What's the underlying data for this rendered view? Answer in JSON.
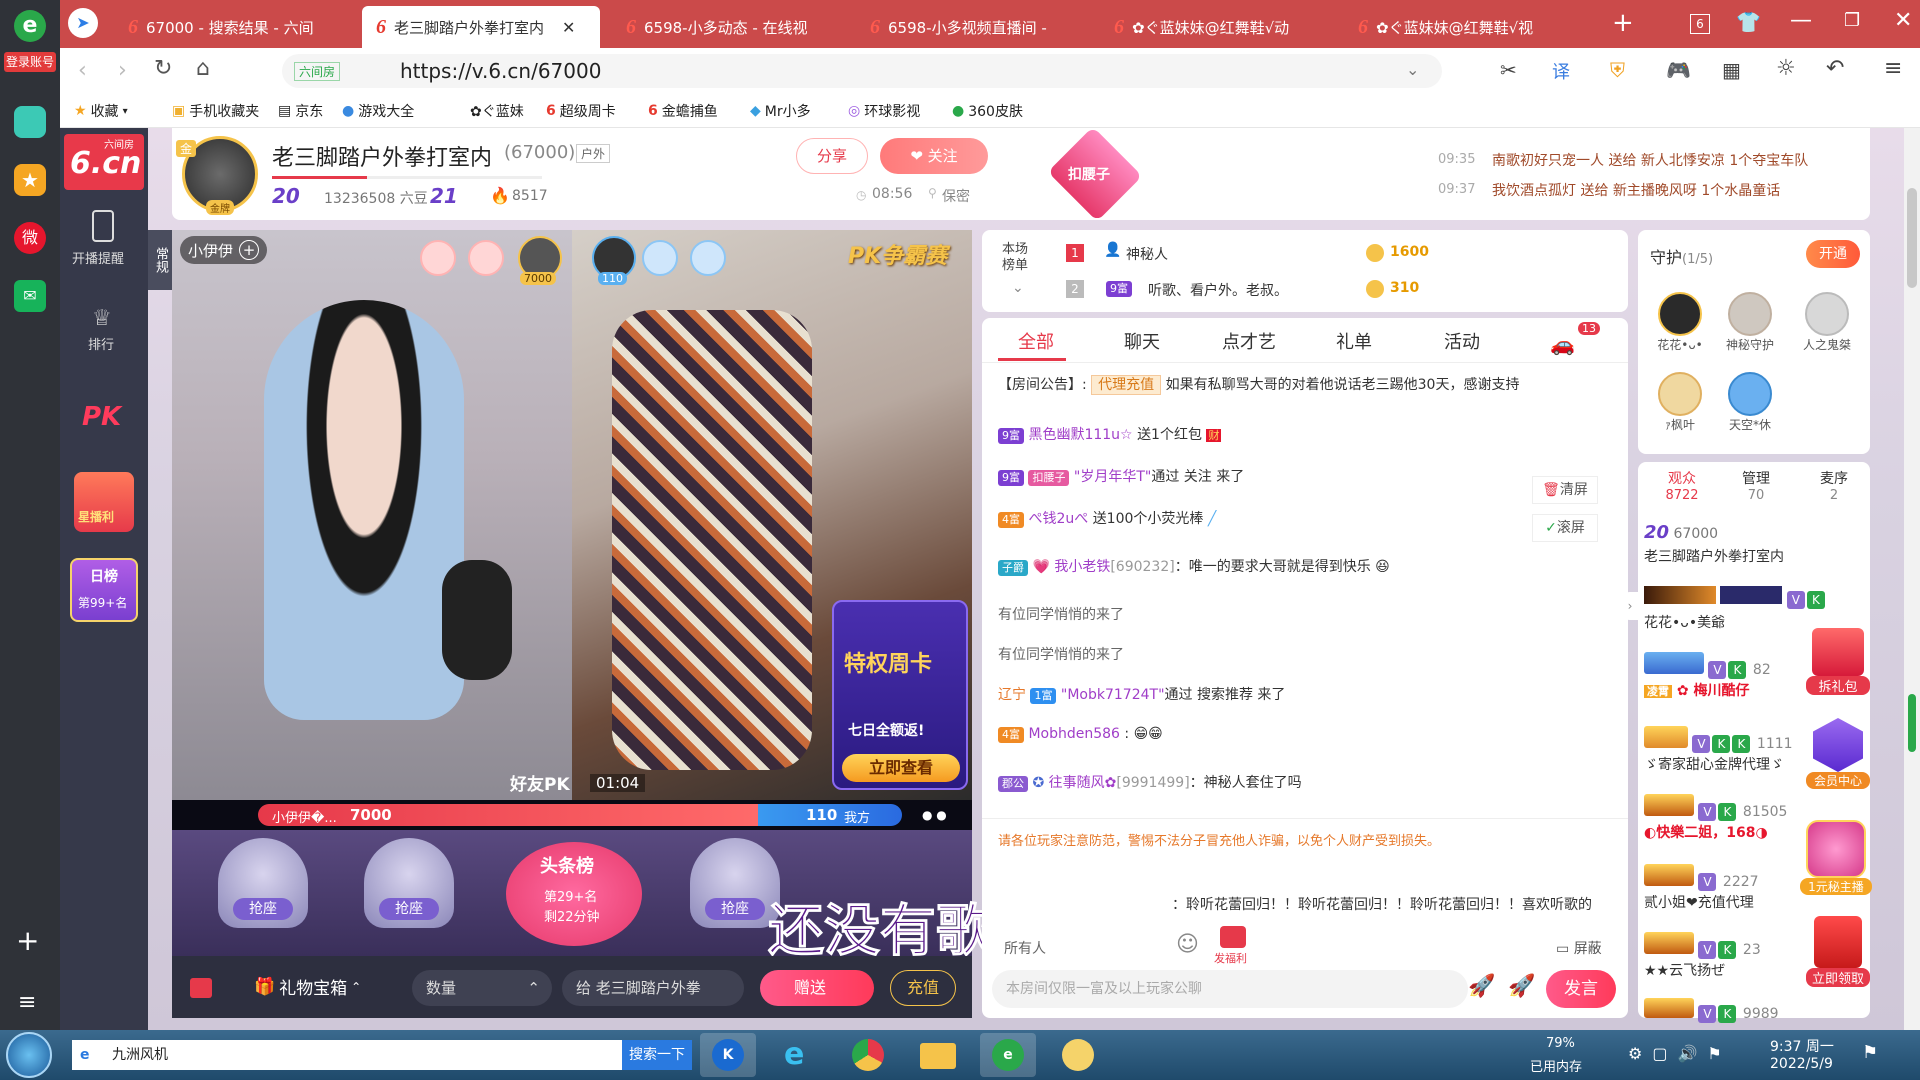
{
  "browser": {
    "login_label": "登录账号",
    "tabs": [
      {
        "title": "67000 - 搜索结果 - 六间"
      },
      {
        "title": "老三脚踏户外拳打室内"
      },
      {
        "title": "6598-小多动态 - 在线视"
      },
      {
        "title": "6598-小多视频直播间 - "
      },
      {
        "title": "✿ぐ蓝妹妹@红舞鞋√动"
      },
      {
        "title": "✿ぐ蓝妹妹@红舞鞋√视"
      }
    ],
    "tab_count": "6",
    "url": "https://v.6.cn/67000",
    "url_site_badge": "六间房",
    "bookmarks": [
      "收藏",
      "手机收藏夹",
      "京东",
      "游戏大全",
      "✿ぐ蓝妹",
      "超级周卡",
      "金蟾捕鱼",
      "Mr小多",
      "环球影视",
      "360皮肤"
    ],
    "translate_label": "译"
  },
  "site_nav": {
    "logo_top": "六间房",
    "logo_main": "6.cn",
    "items": [
      "开播提醒",
      "排行"
    ],
    "pk_label": "PK",
    "event_label": "星播利",
    "daily_rank_label": "日榜",
    "daily_rank_value": "第99+名"
  },
  "room": {
    "title": "老三脚踏户外拳打室内",
    "room_id": "(67000)",
    "category": "户外",
    "level_1": "20",
    "beans": "13236508 六豆",
    "level_2": "21",
    "fire": "8517",
    "time": "08:56",
    "location": "保密",
    "share_label": "分享",
    "follow_label": "关注",
    "waist_label": "扣腰子",
    "gold_label": "金",
    "avatar_badge": "金牌"
  },
  "notices": [
    {
      "time": "09:35",
      "text": "南歌初好只宠一人 送给 新人北悸安凉 1个夺宝车队"
    },
    {
      "time": "09:37",
      "text": "我饮酒点孤灯 送给 新主播晚风呀 1个水晶童话"
    }
  ],
  "video": {
    "side_tab": "常规",
    "anchor_name": "小伊伊",
    "left_score_badge": "7000",
    "right_score_badge": "110",
    "pk_logo": "PK争霸赛",
    "friend_pk": "好友PK",
    "timer": "01:04",
    "bar_left_name": "小伊伊�...",
    "bar_left_score": "7000",
    "bar_right_score": "110",
    "bar_right_label": "我方",
    "promo_title": "特权周卡",
    "promo_sub": "七日全额返!",
    "promo_btn": "立即查看",
    "seats": [
      "抢座",
      "抢座",
      "抢座"
    ],
    "headline_title": "头条榜",
    "headline_rank": "第29+名",
    "headline_time": "剩22分钟",
    "lyrics": "还没有歌词哦",
    "gift_box_label": "礼物宝箱",
    "qty_placeholder": "数量",
    "give_to": "给  老三脚踏户外拳",
    "give_btn": "赠送",
    "recharge_btn": "充值"
  },
  "ranking": {
    "label": "本场榜单",
    "rows": [
      {
        "rank": "1",
        "name": "神秘人",
        "value": "1600"
      },
      {
        "rank": "2",
        "badge": "9富",
        "name": "听歌、看户外。老叔。",
        "value": "310"
      }
    ]
  },
  "chat": {
    "tabs": [
      "全部",
      "聊天",
      "点才艺",
      "礼单",
      "活动"
    ],
    "car_count": "13",
    "announcement_label": "【房间公告】:",
    "announcement_tag": "代理充值",
    "announcement_text": "如果有私聊骂大哥的对着他说话老三踢他30天，感谢支持",
    "clear_label": "清屏",
    "scroll_label": "滚屏",
    "messages": [
      {
        "badge": "9富",
        "name": "黑色幽默111u☆",
        "text": "送1个红包"
      },
      {
        "badge": "9富",
        "badge2": "扣腰子",
        "name": "\"岁月年华T\"",
        "text": "通过 关注 来了"
      },
      {
        "badge": "4富",
        "name": "ぺ钱2uぺ",
        "text": "送100个小荧光棒"
      },
      {
        "badge": "子爵",
        "name": "我小老铁",
        "id": "[690232]",
        "text": "：唯一的要求大哥就是得到快乐"
      },
      {
        "text": "有位同学悄悄的来了"
      },
      {
        "text": "有位同学悄悄的来了"
      },
      {
        "loc": "辽宁",
        "badge": "1富",
        "name": "\"Mobk71724T\"",
        "text": "通过 搜索推荐 来了"
      },
      {
        "badge": "4富",
        "name": "Mobhden586",
        "text": ":"
      },
      {
        "badge": "郡公",
        "name": "往事随风✿",
        "id": "[9991499]",
        "text": "：神秘人套住了吗"
      }
    ],
    "warning": "请各位玩家注意防范，警惕不法分子冒充他人诈骗，以免个人财产受到损失。",
    "repeat_text": "：聆听花蕾回归！！聆听花蕾回归！！聆听花蕾回归！！喜欢听歌的",
    "to_label": "所有人",
    "welfare_label": "发福利",
    "block_label": "屏蔽",
    "input_placeholder": "本房间仅限一富及以上玩家公聊",
    "send_label": "发言"
  },
  "guard": {
    "title": "守护",
    "count": "(1/5)",
    "open_label": "开通",
    "members": [
      "花花•ᴗ•",
      "神秘守护",
      "人之鬼桀",
      "ｧ枫叶",
      "天空*休"
    ]
  },
  "audience": {
    "tabs": [
      {
        "label": "观众",
        "value": "8722"
      },
      {
        "label": "管理",
        "value": "70"
      },
      {
        "label": "麦序",
        "value": "2"
      }
    ],
    "list": [
      {
        "level": "20",
        "text": "67000",
        "sub": "老三脚踏户外拳打室内"
      },
      {
        "text": "",
        "sub": "花花•ᴗ•美爺"
      },
      {
        "text": "82",
        "sub": "梅川酷仔"
      },
      {
        "text": "1111",
        "sub": "ゞ寄家甜心金牌代理ゞ"
      },
      {
        "text": "81505",
        "sub": "快樂二姐，168"
      },
      {
        "text": "2227",
        "sub": "贰小姐❤充值代理"
      },
      {
        "text": "23",
        "sub": "★★云飞扬ぜ"
      },
      {
        "text": "9989",
        "sub": ""
      }
    ]
  },
  "floating": {
    "red_packet": "拆礼包",
    "member_center": "会员中心",
    "one_yuan": "1元秘主播",
    "claim": "立即领取"
  },
  "taskbar": {
    "ie_text": "九洲风机",
    "search_btn": "搜索一下",
    "mem_pct": "79%",
    "mem_label": "已用内存",
    "time": "9:37 周一",
    "date": "2022/5/9"
  }
}
